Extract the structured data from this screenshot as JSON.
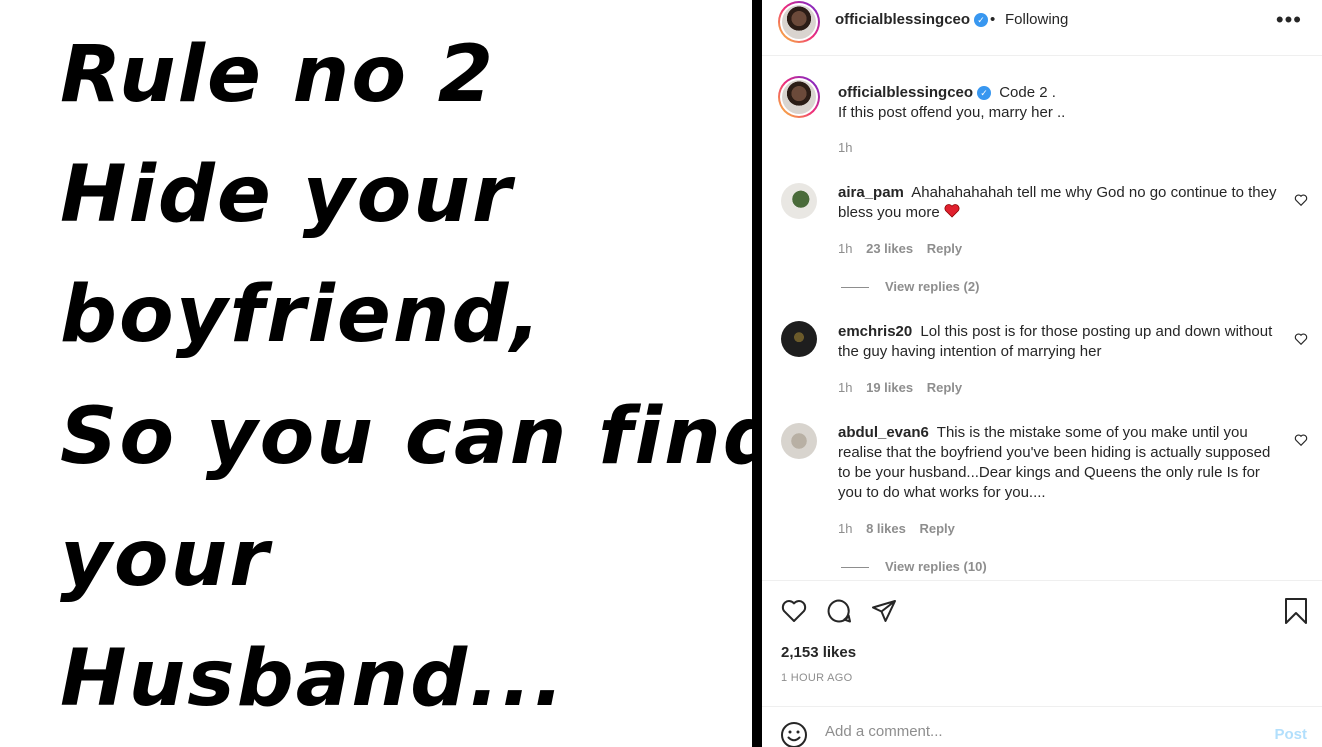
{
  "post_image": {
    "lines": [
      "Rule no 2",
      "Hide your",
      "boyfriend,",
      "So you can find",
      "your",
      "Husband..."
    ]
  },
  "header": {
    "username": "officialblessingceo",
    "verified_glyph": "✓",
    "separator": "•",
    "follow_status": "Following",
    "more_icon": "•••"
  },
  "caption": {
    "username": "officialblessingceo",
    "line1": "Code 2 .",
    "line2": "If this post offend you, marry her ..",
    "time": "1h"
  },
  "comments": [
    {
      "username": "aira_pam",
      "text": "Ahahahahahah tell me why God no go continue to they bless you more",
      "emoji": "❤️",
      "time": "1h",
      "likes": "23 likes",
      "reply": "Reply",
      "view_replies": "View replies (2)"
    },
    {
      "username": "emchris20",
      "text": "Lol this post is for those posting up and down without the guy having intention of marrying her",
      "time": "1h",
      "likes": "19 likes",
      "reply": "Reply"
    },
    {
      "username": "abdul_evan6",
      "text": "This is the mistake some of you make until you realise that the boyfriend you've been hiding is actually supposed to be your husband...Dear kings and Queens the only rule Is for you to do what works for you....",
      "time": "1h",
      "likes": "8 likes",
      "reply": "Reply",
      "view_replies": "View replies (10)"
    }
  ],
  "actions": {
    "likes": "2,153 likes",
    "time_ago": "1 HOUR AGO"
  },
  "add_comment": {
    "placeholder": "Add a comment...",
    "post_label": "Post"
  },
  "colors": {
    "verified": "#3897f0",
    "heart_red": "#ed4956",
    "muted": "#8e8e8e",
    "post_disabled": "#b2dffc"
  }
}
